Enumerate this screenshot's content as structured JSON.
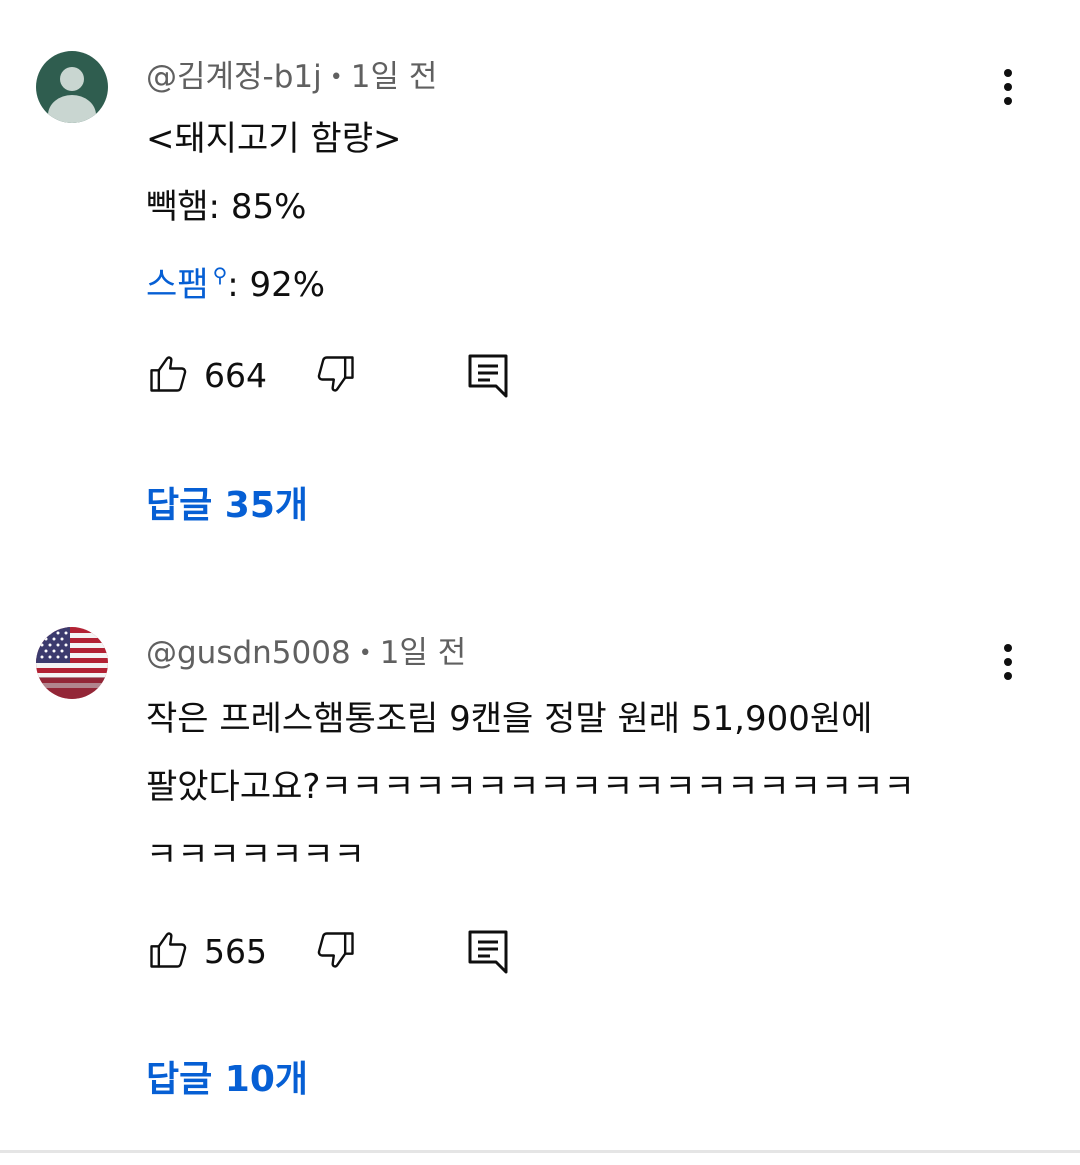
{
  "comments": [
    {
      "author": "@김계정-b1j",
      "separator": "•",
      "time": "1일 전",
      "lines": [
        "<돼지고기 함량>",
        "빽햄: 85%"
      ],
      "search_term": "스팸",
      "search_term_suffix": ": 92%",
      "likes": "664",
      "replies_label": "답글 35개",
      "avatar": "default-person-icon"
    },
    {
      "author": "@gusdn5008",
      "separator": "•",
      "time": "1일 전",
      "lines": [
        "작은 프레스햄통조림 9캔을 정말 원래 51,900원에",
        "팔았다고요?ㅋㅋㅋㅋㅋㅋㅋㅋㅋㅋㅋㅋㅋㅋㅋㅋㅋㅋㅋ",
        "ㅋㅋㅋㅋㅋㅋㅋ"
      ],
      "likes": "565",
      "replies_label": "답글 10개",
      "avatar": "us-flag-avatar"
    }
  ],
  "icons": {
    "like": "thumbs-up-icon",
    "dislike": "thumbs-down-icon",
    "reply": "reply-comment-icon",
    "menu": "more-vert-icon",
    "search": "magnifier-icon"
  },
  "colors": {
    "link": "#065fd4",
    "meta": "#606060",
    "text": "#0f0f0f"
  }
}
